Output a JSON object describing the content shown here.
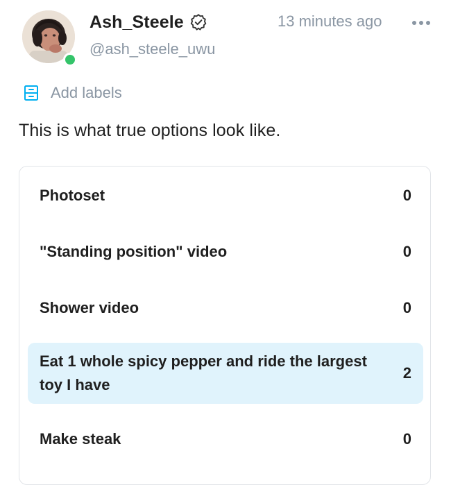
{
  "post": {
    "author": {
      "display_name": "Ash_Steele",
      "handle": "@ash_steele_uwu",
      "verified_icon": "verified-badge-icon",
      "online": true,
      "status_color": "#34c46a"
    },
    "timestamp": "13 minutes ago",
    "more_icon": "more-horizontal-icon",
    "labels": {
      "icon": "label-icon",
      "text": "Add labels",
      "accent_color": "#00aff0"
    },
    "text": "This is what true options look like."
  },
  "poll": {
    "selected_color": "#e0f3fc",
    "options": [
      {
        "label": "Photoset",
        "votes": "0",
        "selected": false
      },
      {
        "label": "\"Standing position\" video",
        "votes": "0",
        "selected": false
      },
      {
        "label": "Shower video",
        "votes": "0",
        "selected": false
      },
      {
        "label": "Eat 1 whole spicy pepper and ride the largest toy I have",
        "votes": "2",
        "selected": true
      },
      {
        "label": "Make steak",
        "votes": "0",
        "selected": false
      }
    ]
  }
}
